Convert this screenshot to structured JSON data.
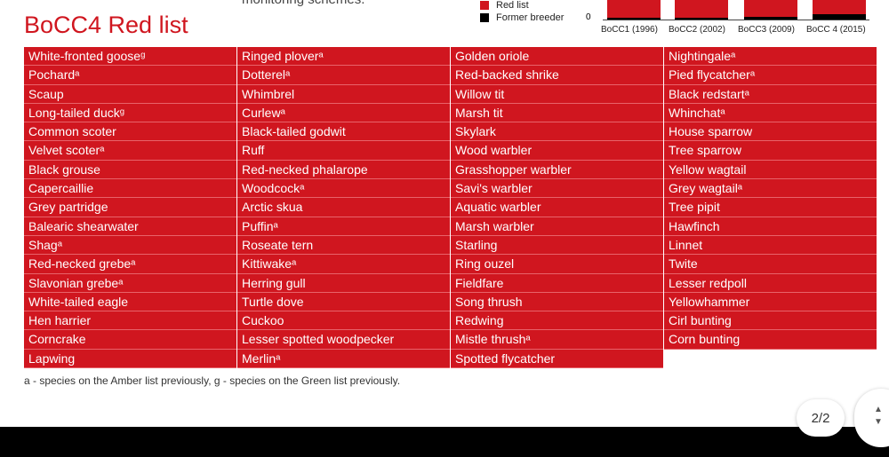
{
  "intro_text": "monitoring schemes.",
  "legend": {
    "red_list": "Red list",
    "former_breeder": "Former breeder",
    "colors": {
      "red_list": "#d0161f",
      "former_breeder": "#000000"
    }
  },
  "chart_data": {
    "type": "bar",
    "stacked": true,
    "categories": [
      "BoCC1 (1996)",
      "BoCC2 (2002)",
      "BoCC3 (2009)",
      "BoCC 4 (2015)"
    ],
    "y_ticks": [
      "0"
    ],
    "series": [
      {
        "name": "Red list"
      },
      {
        "name": "Former breeder"
      }
    ]
  },
  "title": "BoCC4 Red list",
  "columns": [
    [
      "White-fronted gooseᵍ",
      "Pochardᵃ",
      "Scaup",
      "Long-tailed duckᵍ",
      "Common scoter",
      "Velvet scoterᵃ",
      "Black grouse",
      "Capercaillie",
      "Grey partridge",
      "Balearic shearwater",
      "Shagᵃ",
      "Red-necked grebeᵃ",
      "Slavonian grebeᵃ",
      "White-tailed eagle",
      "Hen harrier",
      "Corncrake",
      "Lapwing"
    ],
    [
      "Ringed ploverᵃ",
      "Dotterelᵃ",
      "Whimbrel",
      "Curlewᵃ",
      "Black-tailed godwit",
      "Ruff",
      "Red-necked phalarope",
      "Woodcockᵃ",
      "Arctic skua",
      "Puffinᵃ",
      "Roseate tern",
      "Kittiwakeᵃ",
      "Herring gull",
      "Turtle dove",
      "Cuckoo",
      "Lesser spotted woodpecker",
      "Merlinᵃ"
    ],
    [
      "Golden oriole",
      "Red-backed shrike",
      "Willow tit",
      "Marsh tit",
      "Skylark",
      "Wood warbler",
      "Grasshopper warbler",
      "Savi's warbler",
      "Aquatic warbler",
      "Marsh warbler",
      "Starling",
      "Ring ouzel",
      "Fieldfare",
      "Song thrush",
      "Redwing",
      "Mistle thrushᵃ",
      "Spotted flycatcher"
    ],
    [
      "Nightingaleᵃ",
      "Pied flycatcherᵃ",
      "Black redstartᵃ",
      "Whinchatᵃ",
      "House sparrow",
      "Tree sparrow",
      "Yellow wagtail",
      "Grey wagtailᵃ",
      "Tree pipit",
      "Hawfinch",
      "Linnet",
      "Twite",
      "Lesser redpoll",
      "Yellowhammer",
      "Cirl bunting",
      "Corn bunting"
    ]
  ],
  "footnote": "a - species on the Amber list previously, g - species on the Green list previously.",
  "pager": "2/2",
  "scroll_up": "▲",
  "scroll_down": "▼"
}
